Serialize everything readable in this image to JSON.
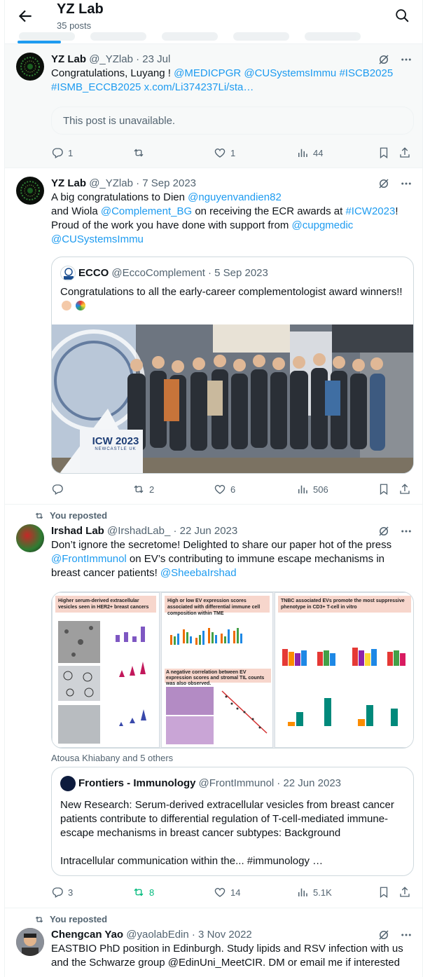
{
  "header": {
    "title": "YZ Lab",
    "subtitle": "35 posts"
  },
  "posts": [
    {
      "name": "YZ Lab",
      "handle": "@_YZlab",
      "date": "· 23 Jul",
      "text_a": "Congratulations, Luyang ! ",
      "links": [
        "@MEDICPGR",
        "@CUSystemsImmu",
        "#ISCB2025",
        "#ISMB_ECCB2025",
        "x.com/Li374237Li/sta…"
      ],
      "unavailable": "This post is unavailable.",
      "stats": {
        "replies": "1",
        "reposts": "",
        "likes": "1",
        "views": "44"
      }
    },
    {
      "name": "YZ Lab",
      "handle": "@_YZlab",
      "date": "· 7 Sep 2023",
      "t1": "A big congratulations to Dien ",
      "l1": "@nguyenvandien82",
      "t2": "and Wiola ",
      "l2": "@Complement_BG",
      "t3": " on receiving the ECR awards at ",
      "l3": "#ICW2023",
      "t4": "!",
      "t5": "Proud of the work you have done with support from ",
      "l4": "@cupgmedic",
      "l5": "@CUSystemsImmu",
      "quote": {
        "name": "ECCO",
        "handle": "@EccoComplement",
        "date": "· 5 Sep 2023",
        "text": "Congratulations to all the early-career complementologist award winners!!",
        "podium_text": "ICW 2023",
        "podium_sub": "NEWCASTLE UK"
      },
      "stats": {
        "replies": "",
        "reposts": "2",
        "likes": "6",
        "views": "506"
      }
    },
    {
      "reposted": "You reposted",
      "name": "Irshad Lab",
      "handle": "@IrshadLab_",
      "date": "· 22 Jun 2023",
      "t1": "Don’t ignore the secretome! Delighted to share our paper hot of the press",
      "l1": "@FrontImmunol",
      "t2": " on EV’s contributing to immune escape mechanisms in breast cancer patients! ",
      "l2": "@SheebaIrshad",
      "panel1_title": "Higher serum-derived extracellular vesicles seen in HER2+ breast cancers",
      "panel2_title": "High or low EV expression scores associated with differential immune cell composition within TME",
      "panel2b_title": "A negative correlation between EV expression scores and stromal TIL counts was also observed.",
      "panel3_title": "TNBC associated EVs promote the most suppressive phenotype in CD3+ T-cell in vitro",
      "tagged": "Atousa Khiabany and 5 others",
      "quote": {
        "name": "Frontiers - Immunology",
        "handle": "@FrontImmunol",
        "date": "· 22 Jun 2023",
        "text1": "New Research: Serum-derived extracellular vesicles from breast cancer patients contribute to differential regulation of T-cell-mediated immune-escape mechanisms in breast cancer subtypes: Background",
        "text2": "Intracellular communication within the... #immunology …"
      },
      "stats": {
        "replies": "3",
        "reposts": "8",
        "likes": "14",
        "views": "5.1K"
      }
    },
    {
      "reposted": "You reposted",
      "name": "Chengcan Yao",
      "handle": "@yaolabEdin",
      "date": "· 3 Nov 2022",
      "text": "EASTBIO PhD position in Edinburgh. Study lipids and RSV infection with us and the Schwarze group @EdinUni_MeetCIR. DM or email me if interested"
    }
  ],
  "colors": {
    "accent": "#1d9bf0",
    "muted": "#536471",
    "repost_active": "#00ba7c"
  }
}
